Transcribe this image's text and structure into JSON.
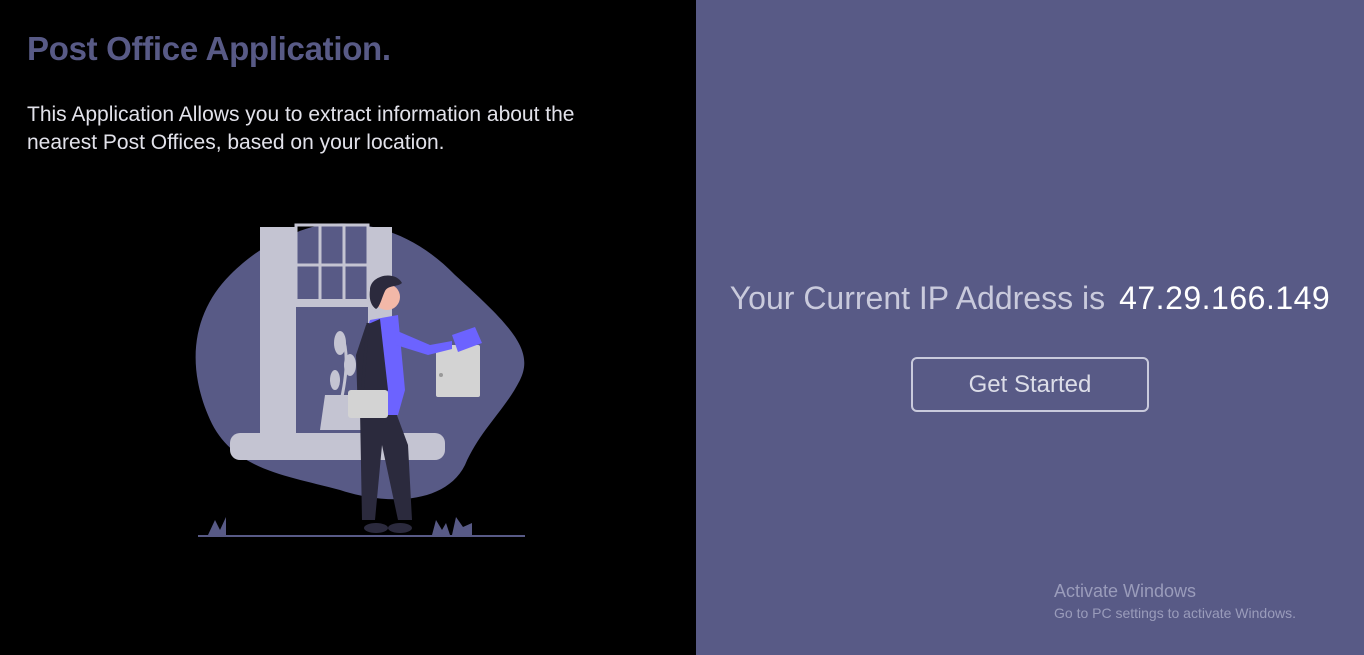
{
  "app": {
    "title": "Post Office Application.",
    "description": "This Application Allows you to extract information about the nearest Post Offices, based on your location."
  },
  "ip_panel": {
    "label": "Your Current IP Address is",
    "ip_address": "47.29.166.149",
    "button_label": "Get Started"
  },
  "watermark": {
    "title": "Activate Windows",
    "subtitle": "Go to PC settings to activate Windows."
  },
  "illustration": {
    "icon": "mailman-delivering-letter-illustration"
  },
  "colors": {
    "left_bg": "#000000",
    "right_bg": "#585a86",
    "accent": "#585a86",
    "accent_bright": "#6c63ff"
  }
}
